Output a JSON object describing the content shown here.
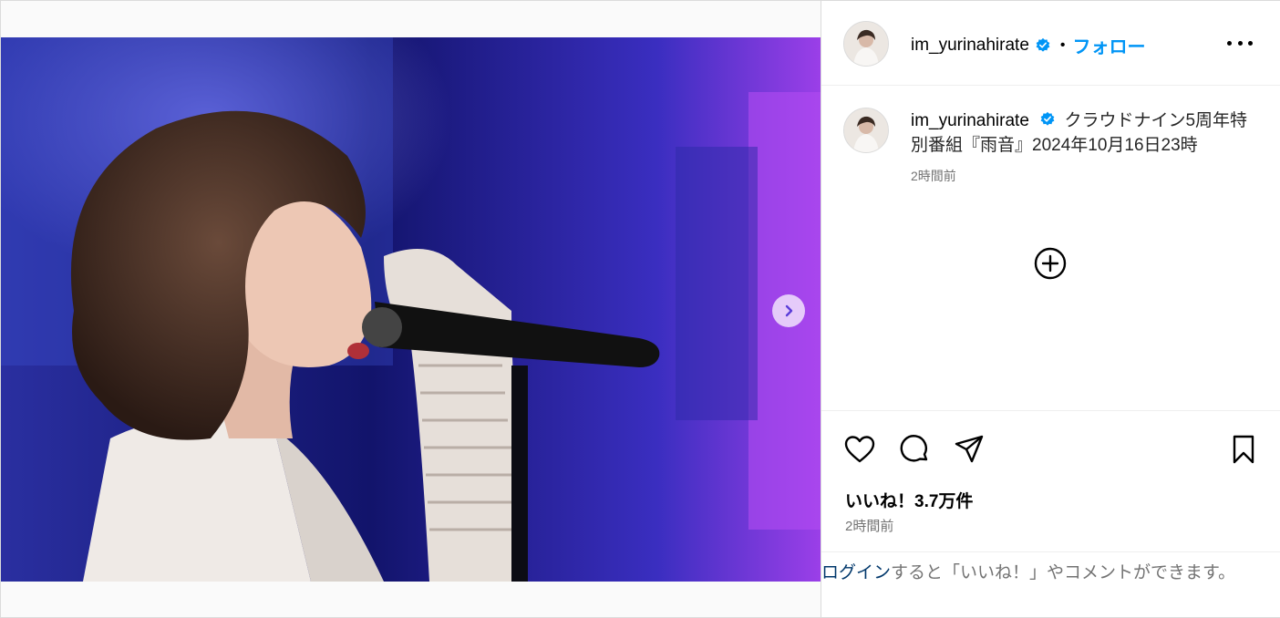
{
  "post": {
    "username": "im_yurinahirate",
    "follow_label": "フォロー",
    "separator": "•",
    "caption": "クラウドナイン5周年特別番組『雨音』2024年10月16日23時",
    "caption_time": "2時間前",
    "likes": "いいね！3.7万件",
    "post_time": "2時間前",
    "login_link": "ログイン",
    "login_prompt": "すると「いいね！」やコメントができます。"
  },
  "icons": {
    "verified": "verified-badge-icon",
    "more": "more-options-icon",
    "next": "chevron-right-icon",
    "add_comment": "plus-circle-icon",
    "like": "heart-icon",
    "comment": "comment-icon",
    "share": "paper-plane-icon",
    "save": "bookmark-icon"
  },
  "colors": {
    "link_blue": "#0095f6",
    "verified_blue": "#0095f6",
    "secondary_text": "#737373",
    "dark_link": "#00376b"
  }
}
